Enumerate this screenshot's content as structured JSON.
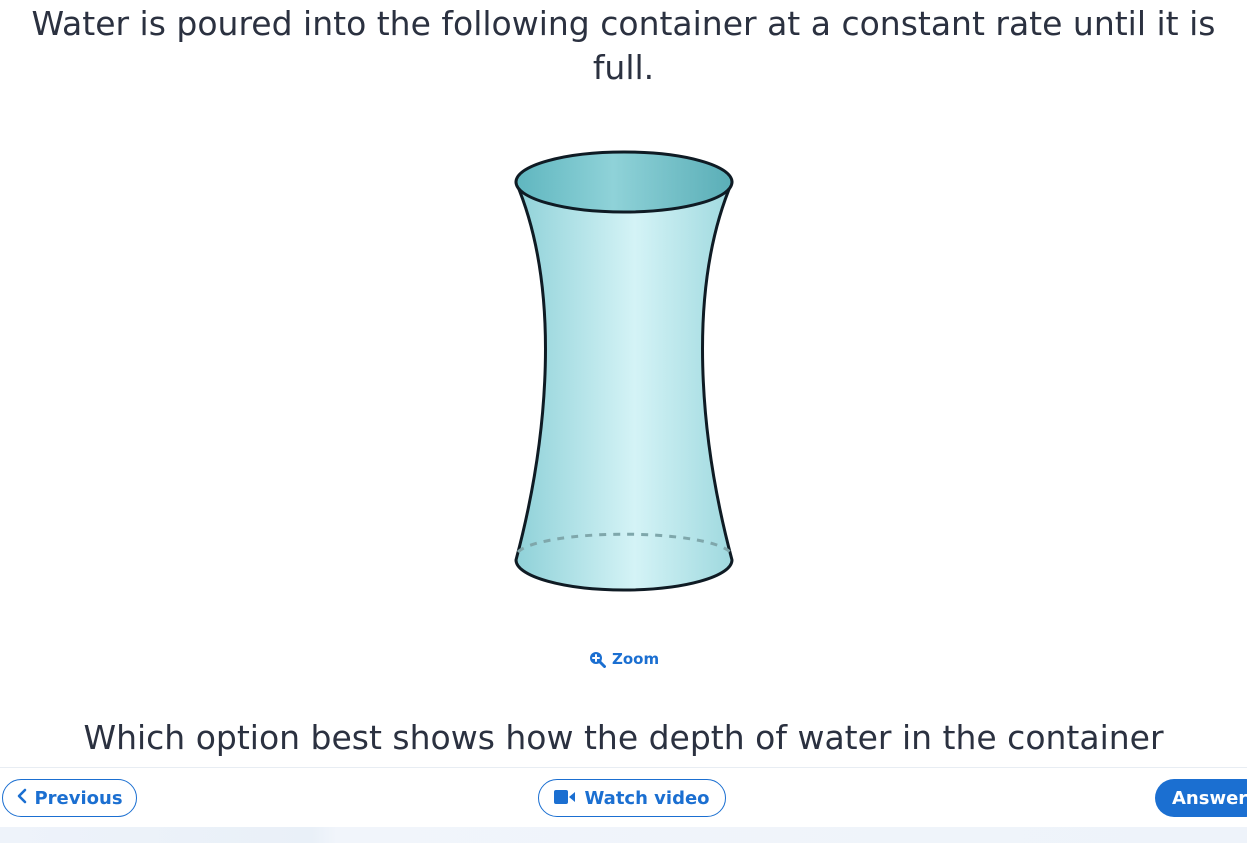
{
  "question": {
    "intro": "Water is poured into the following container at a constant rate until it is full.",
    "prompt": "Which option best shows how the depth of water in the container"
  },
  "figure": {
    "shape": "hourglass-shaped container (narrow waist, wider top and bottom)",
    "fill_color": "#a8dde3",
    "top_color": "#6fc0c8",
    "outline_color": "#0f1b24"
  },
  "zoom": {
    "label": "Zoom",
    "icon": "zoom-in-icon"
  },
  "nav": {
    "previous_label": "Previous",
    "previous_icon": "chevron-left-icon",
    "watch_video_label": "Watch video",
    "watch_video_icon": "video-camera-icon",
    "answer_label": "Answer"
  },
  "colors": {
    "accent": "#1b6fd1",
    "text": "#2b3140"
  }
}
